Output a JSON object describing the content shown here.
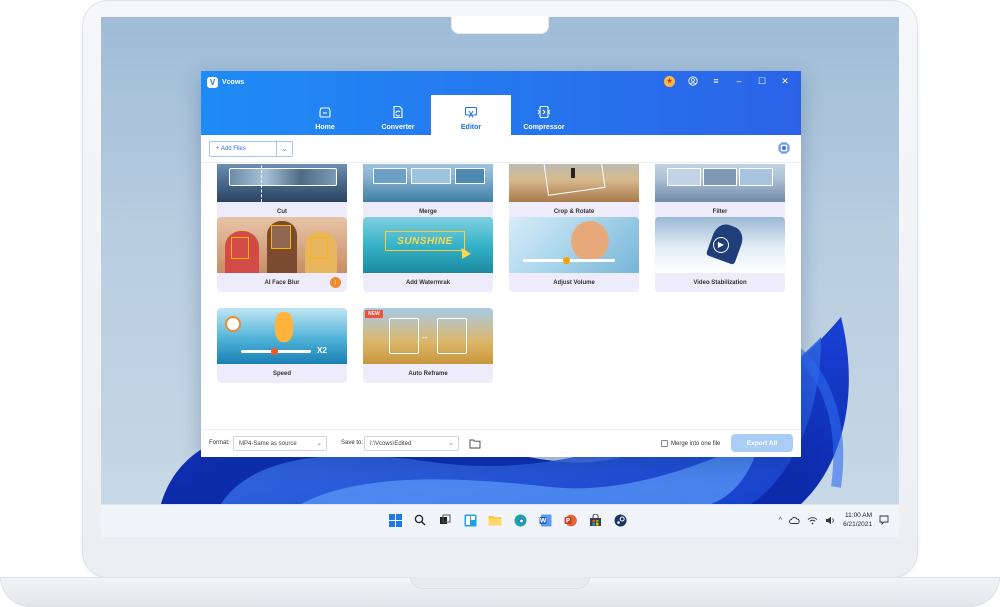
{
  "app": {
    "name": "Vcows",
    "logo_letter": "V",
    "accent": "#2b6ef0",
    "header_gradient": [
      "#1f8cf5",
      "#2b63e8"
    ]
  },
  "nav": {
    "tabs": [
      {
        "label": "Home",
        "icon": "home-icon",
        "active": false
      },
      {
        "label": "Converter",
        "icon": "converter-icon",
        "active": false
      },
      {
        "label": "Editor",
        "icon": "editor-icon",
        "active": true
      },
      {
        "label": "Compressor",
        "icon": "compressor-icon",
        "active": false
      }
    ]
  },
  "toolbar": {
    "add_files": "Add Files",
    "add_plus": "+"
  },
  "tools": [
    {
      "label": "Cut"
    },
    {
      "label": "Merge"
    },
    {
      "label": "Crop & Rotate"
    },
    {
      "label": "Filter"
    },
    {
      "label": "AI Face Blur"
    },
    {
      "label": "Add Watermrak",
      "thumb_text": "SUNSHINE"
    },
    {
      "label": "Adjust Volume"
    },
    {
      "label": "Video Stabilization"
    },
    {
      "label": "Speed",
      "thumb_text": "X2"
    },
    {
      "label": "Auto Reframe",
      "badge": "NEW"
    }
  ],
  "footer": {
    "format_label": "Format:",
    "format_value": "MP4-Same as source",
    "save_label": "Save to:",
    "save_value": "I:\\Vcows\\Edited",
    "merge_label": "Merge into one file",
    "export_label": "Export All"
  },
  "taskbar": {
    "time": "11:00 AM",
    "date": "6/21/2021",
    "tray_chevron": "^"
  }
}
